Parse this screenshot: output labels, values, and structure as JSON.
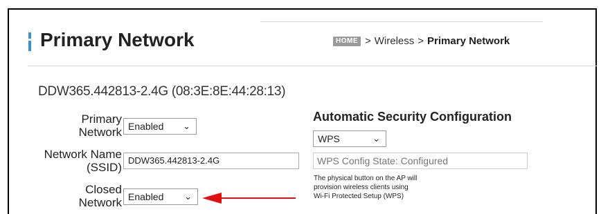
{
  "header": {
    "title": "Primary Network",
    "breadcrumb": {
      "home_label": "HOME",
      "separator": ">",
      "items": [
        "Wireless",
        "Primary Network"
      ]
    }
  },
  "network": {
    "ssid_heading": "DDW365.442813-2.4G (08:3E:8E:44:28:13)",
    "primary_network": {
      "label_line1": "Primary",
      "label_line2": "Network",
      "value": "Enabled"
    },
    "network_name": {
      "label_line1": "Network Name",
      "label_line2": "(SSID)",
      "value": "DDW365.442813-2.4G"
    },
    "closed_network": {
      "label_line1": "Closed",
      "label_line2": "Network",
      "value": "Enabled"
    }
  },
  "security": {
    "heading": "Automatic Security Configuration",
    "mode": "WPS",
    "state": "WPS Config State: Configured",
    "note_lines": [
      "The physical button on the AP will",
      "provision wireless clients using",
      "Wi-Fi Protected Setup (WPS)"
    ]
  },
  "colors": {
    "accent": "#3a8fd6",
    "annotation_arrow": "#e01010"
  },
  "icons": {
    "dropdown": "chevron-down-icon",
    "annotation": "red-arrow-icon"
  }
}
